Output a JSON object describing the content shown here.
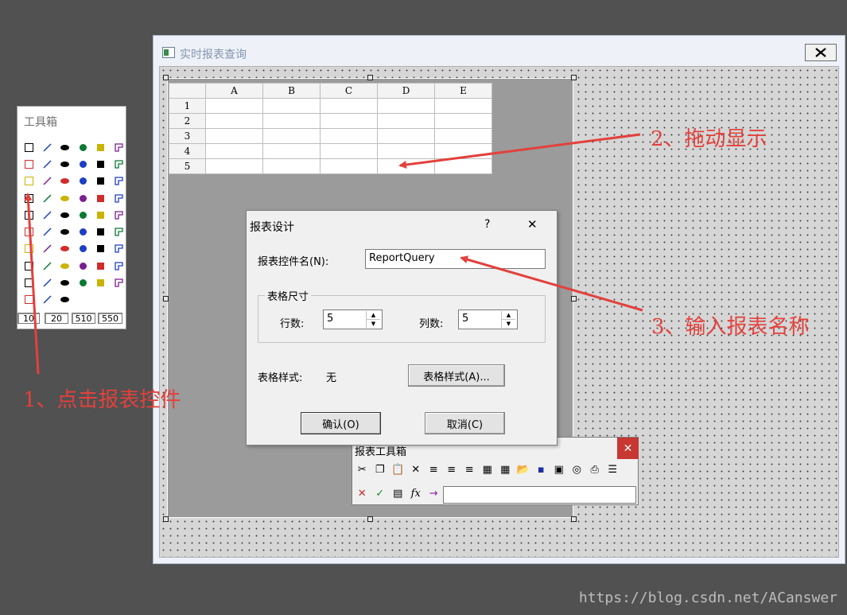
{
  "toolbox": {
    "title": "工具箱",
    "icon_names": [
      "new-doc-icon",
      "open-folder-icon",
      "import-icon",
      "save-icon",
      "picture-icon",
      "chart-icon",
      "pointer-icon",
      "line-icon",
      "ellipse-icon",
      "circle-icon",
      "rectangle-icon",
      "frame-icon",
      "polyline-icon",
      "pie-icon",
      "text-icon",
      "rounded-rect-icon",
      "label-icon",
      "tree-icon",
      "report-control-icon",
      "image-icon",
      "grid-icon",
      "flow-icon",
      "scale-icon",
      "percent-icon",
      "group-icon",
      "bus-icon",
      "undo-icon",
      "redo-icon",
      "cut-icon",
      "copy-icon",
      "paste-icon",
      "align-icon",
      "align-center-icon",
      "align-right-icon",
      "flip-icon",
      "mirror-icon",
      "lock-icon",
      "dot-icon",
      "layer-up-icon",
      "layer-down-icon",
      "send-back-icon",
      "bring-front-icon",
      "halign-icon",
      "valign-icon",
      "distribute-icon",
      "hspace-icon",
      "vspace-icon",
      "same-size-icon",
      "chain-icon",
      "stack-icon",
      "dotted-line-icon",
      "vertical-dots-icon",
      "pattern-icon",
      "palette-icon",
      "link-icon",
      "gradient-icon",
      "hline-icon"
    ],
    "coords": [
      "10",
      "20",
      "510",
      "550"
    ]
  },
  "main_window": {
    "title": "实时报表查询",
    "close_label": "✕"
  },
  "sheet": {
    "columns": [
      "A",
      "B",
      "C",
      "D",
      "E"
    ],
    "rows": [
      "1",
      "2",
      "3",
      "4",
      "5"
    ]
  },
  "dialog": {
    "title": "报表设计",
    "help_label": "?",
    "close_label": "✕",
    "name_label": "报表控件名(N):",
    "name_value": "ReportQuery",
    "group_label": "表格尺寸",
    "rows_label": "行数:",
    "rows_value": "5",
    "cols_label": "列数:",
    "cols_value": "5",
    "style_label": "表格样式:",
    "style_value": "无",
    "style_button": "表格样式(A)...",
    "ok_button": "确认(O)",
    "cancel_button": "取消(C)"
  },
  "report_toolbox": {
    "title": "报表工具箱",
    "close_label": "✕",
    "row1_icons": [
      "cut-icon",
      "copy-icon",
      "paste-icon",
      "delete-icon",
      "align-left-icon",
      "align-center-icon",
      "align-right-icon",
      "merge-icon",
      "split-icon",
      "open-icon",
      "save-icon",
      "book-icon",
      "preview-icon",
      "print-icon",
      "properties-icon"
    ],
    "row2_icons": [
      "cancel-icon",
      "confirm-icon",
      "function-list-icon",
      "fx-icon",
      "arrow-icon"
    ],
    "fx_label": "fx",
    "formula_value": ""
  },
  "annotations": {
    "a1": "1、点击报表控件",
    "a2": "2、拖动显示",
    "a3": "3、输入报表名称"
  },
  "watermark": "https://blog.csdn.net/ACanswer",
  "colors": {
    "annotation": "#e3413c",
    "desktop": "#515151",
    "close_red": "#c83731"
  }
}
